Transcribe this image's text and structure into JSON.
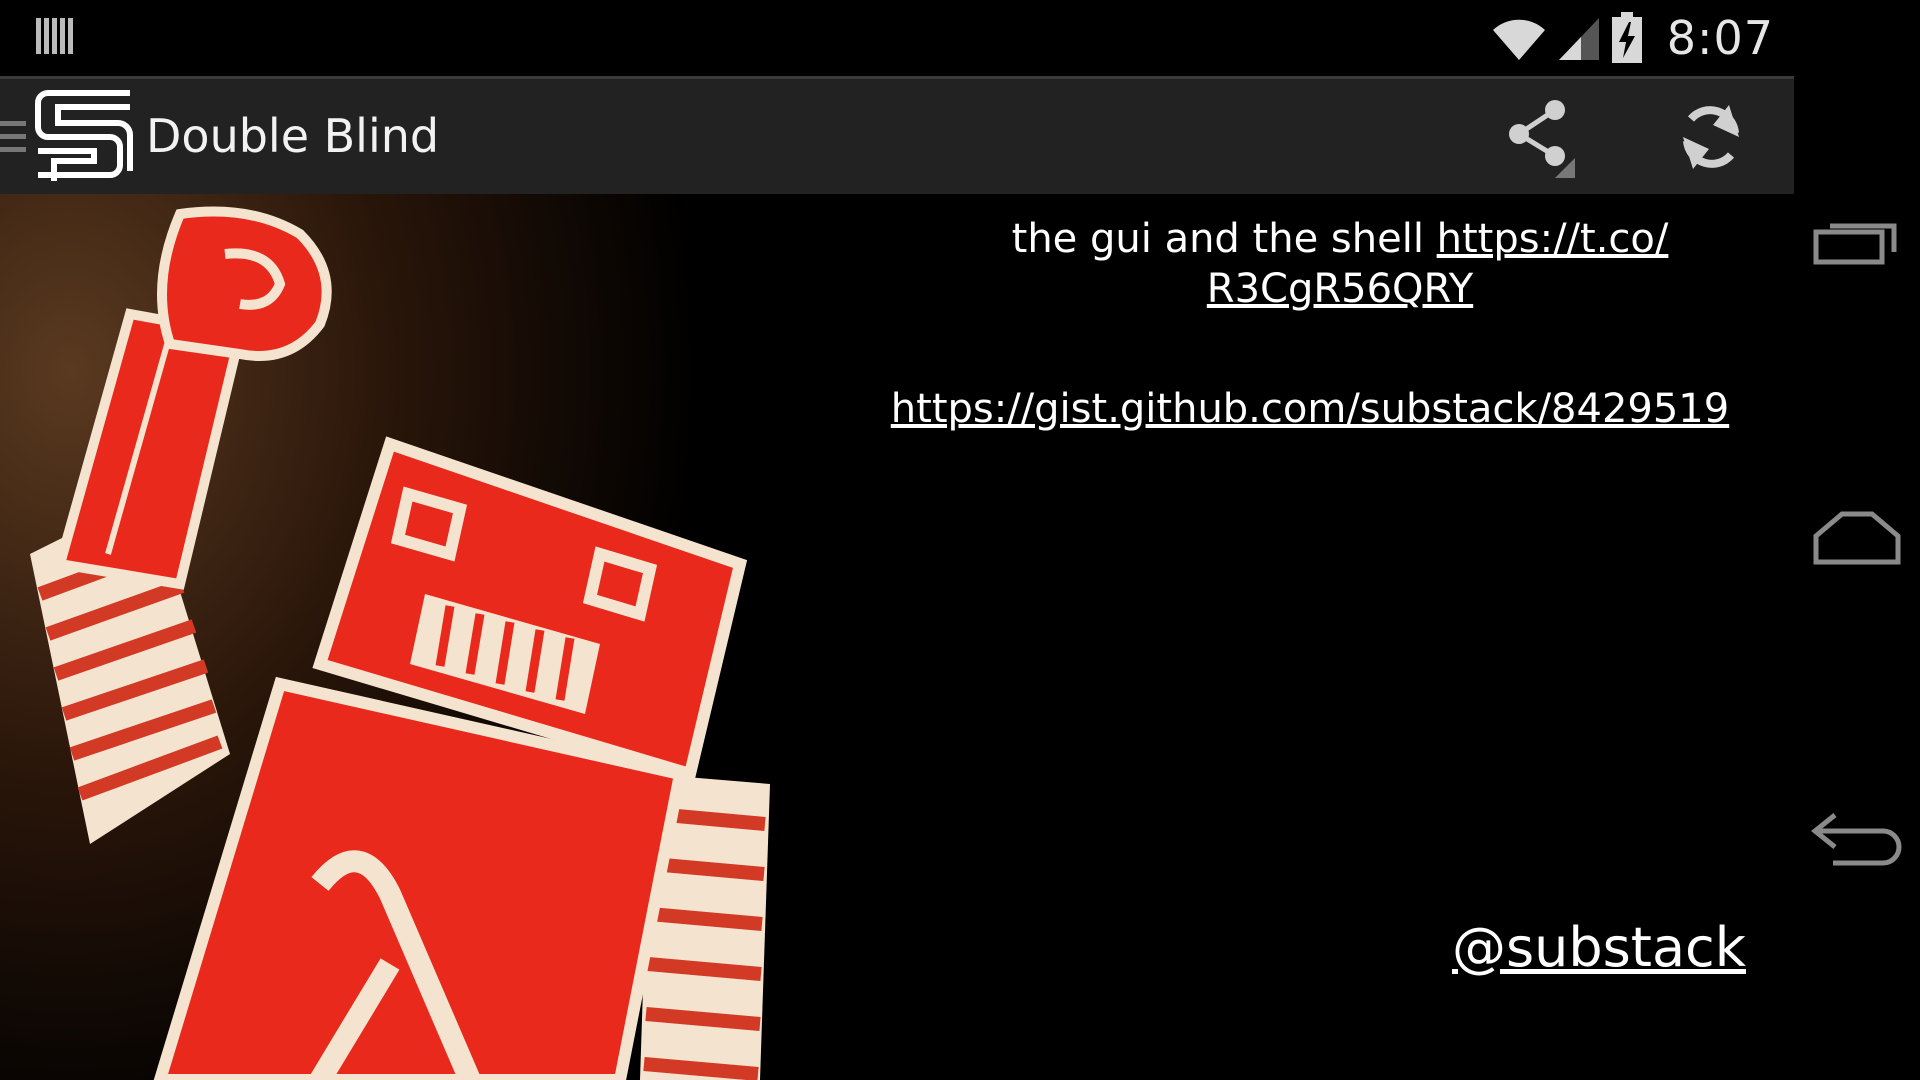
{
  "status_bar": {
    "time": "8:07",
    "icons": [
      "notification-icon",
      "wifi-icon",
      "signal-icon",
      "battery-charging-icon"
    ]
  },
  "action_bar": {
    "title": "Double Blind",
    "actions": [
      "share-icon",
      "refresh-icon"
    ]
  },
  "content": {
    "tweet_text": "the gui and the shell ",
    "tweet_link": "https://t.co/ R3CgR56QRY",
    "gist_link": "https://gist.github.com/substack/8429519",
    "handle": "@substack"
  },
  "nav_bar": {
    "buttons": [
      "recents-icon",
      "home-icon",
      "back-icon"
    ]
  },
  "colors": {
    "background": "#000000",
    "action_bar": "#222222",
    "robot_red": "#e8291c",
    "robot_cream": "#f3e3cf"
  }
}
